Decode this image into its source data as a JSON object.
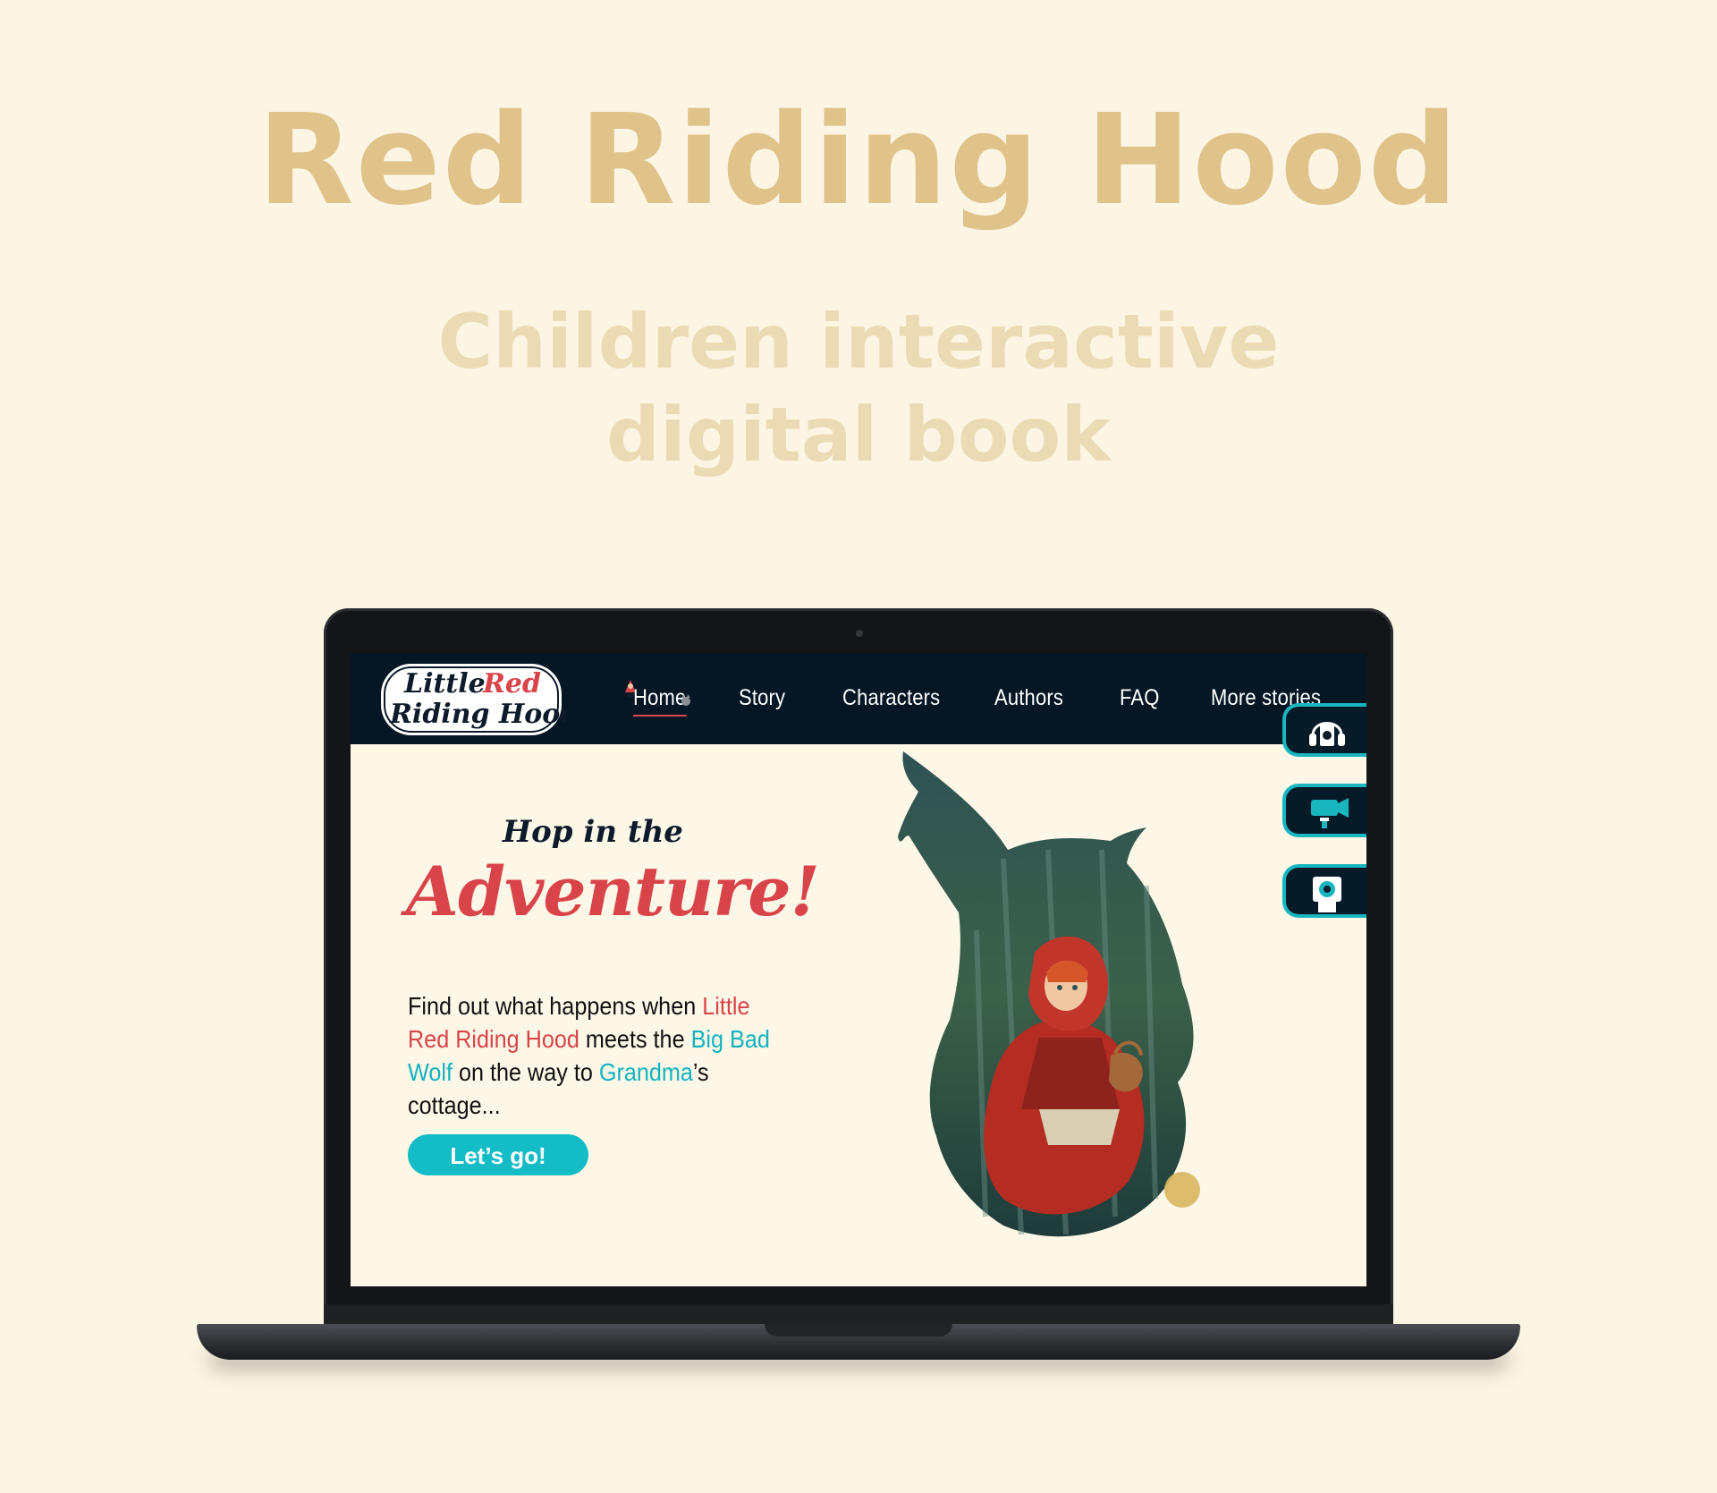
{
  "hero": {
    "title": "Red Riding Hood",
    "subtitle_line1": "Children interactive",
    "subtitle_line2": "digital book"
  },
  "site": {
    "logo_line1_a": "Little",
    "logo_line1_b": "Red",
    "logo_line2": "Riding Hood",
    "nav": [
      "Home",
      "Story",
      "Characters",
      "Authors",
      "FAQ",
      "More stories"
    ],
    "active_nav": "Home"
  },
  "main": {
    "hop": "Hop in the",
    "adventure": "Adventure!",
    "intro": {
      "p1": "Find out what happens when ",
      "lrrh": "Little Red Riding Hood",
      "p2": " meets the ",
      "wolf": "Big Bad Wolf",
      "p3": " on the way to ",
      "grandma": "Grandma",
      "p4": "’s cottage..."
    },
    "cta": "Let’s go!"
  },
  "side_buttons": [
    "audio-player-icon",
    "video-camera-icon",
    "photo-camera-icon"
  ],
  "colors": {
    "background": "#fdf5e4",
    "hero_title": "#dfc38b",
    "nav_bg": "#051624",
    "accent_red": "#d9444a",
    "accent_teal": "#14bcc6"
  }
}
